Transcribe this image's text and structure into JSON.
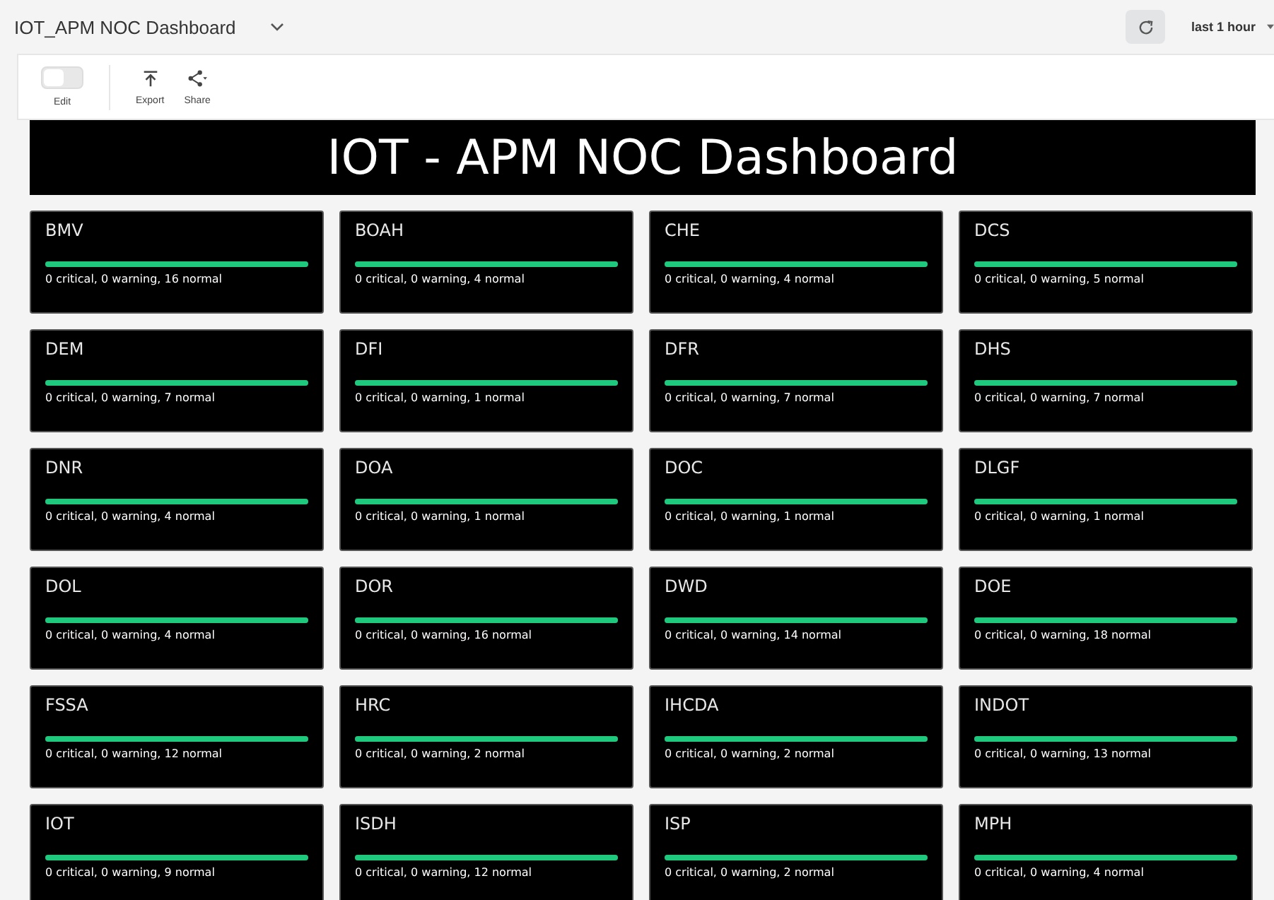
{
  "header": {
    "title": "IOT_APM NOC Dashboard",
    "time_range": "last 1 hour"
  },
  "toolbar": {
    "edit": {
      "label": "Edit",
      "on": false
    },
    "export": {
      "label": "Export"
    },
    "share": {
      "label": "Share"
    }
  },
  "banner": {
    "title": "IOT - APM NOC Dashboard"
  },
  "cards": [
    {
      "name": "BMV",
      "level": 1,
      "status": "0 critical, 0 warning, 16 normal"
    },
    {
      "name": "BOAH",
      "level": 1,
      "status": "0 critical, 0 warning, 4 normal"
    },
    {
      "name": "CHE",
      "level": 1,
      "status": "0 critical, 0 warning, 4 normal"
    },
    {
      "name": "DCS",
      "level": 1,
      "status": "0 critical, 0 warning, 5 normal"
    },
    {
      "name": "DEM",
      "level": 1,
      "status": "0 critical, 0 warning, 7 normal"
    },
    {
      "name": "DFI",
      "level": 1,
      "status": "0 critical, 0 warning, 1 normal"
    },
    {
      "name": "DFR",
      "level": 1,
      "status": "0 critical, 0 warning, 7 normal"
    },
    {
      "name": "DHS",
      "level": 1,
      "status": "0 critical, 0 warning, 7 normal"
    },
    {
      "name": "DNR",
      "level": 1,
      "status": "0 critical, 0 warning, 4 normal"
    },
    {
      "name": "DOA",
      "level": 1,
      "status": "0 critical, 0 warning, 1 normal"
    },
    {
      "name": "DOC",
      "level": 1,
      "status": "0 critical, 0 warning, 1 normal"
    },
    {
      "name": "DLGF",
      "level": 1,
      "status": "0 critical, 0 warning, 1 normal"
    },
    {
      "name": "DOL",
      "level": 1,
      "status": "0 critical, 0 warning, 4 normal"
    },
    {
      "name": "DOR",
      "level": 1,
      "status": "0 critical, 0 warning, 16 normal"
    },
    {
      "name": "DWD",
      "level": 1,
      "status": "0 critical, 0 warning, 14 normal"
    },
    {
      "name": "DOE",
      "level": 1,
      "status": "0 critical, 0 warning, 18 normal"
    },
    {
      "name": "FSSA",
      "level": 1,
      "status": "0 critical, 0 warning, 12 normal"
    },
    {
      "name": "HRC",
      "level": 1,
      "status": "0 critical, 0 warning, 2 normal"
    },
    {
      "name": "IHCDA",
      "level": 1,
      "status": "0 critical, 0 warning, 2 normal"
    },
    {
      "name": "INDOT",
      "level": 1,
      "status": "0 critical, 0 warning, 13 normal"
    },
    {
      "name": "IOT",
      "level": 1,
      "status": "0 critical, 0 warning, 9 normal"
    },
    {
      "name": "ISDH",
      "level": 1,
      "status": "0 critical, 0 warning, 12 normal"
    },
    {
      "name": "ISP",
      "level": 1,
      "status": "0 critical, 0 warning, 2 normal"
    },
    {
      "name": "MPH",
      "level": 1,
      "status": "0 critical, 0 warning, 4 normal"
    }
  ]
}
